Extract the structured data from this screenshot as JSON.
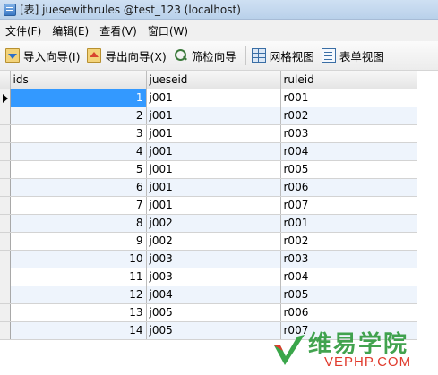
{
  "window": {
    "title": "[表] juesewithrules @test_123 (localhost)"
  },
  "menu": {
    "items": [
      {
        "label": "文件(F)",
        "name": "menu-file"
      },
      {
        "label": "编辑(E)",
        "name": "menu-edit"
      },
      {
        "label": "查看(V)",
        "name": "menu-view"
      },
      {
        "label": "窗口(W)",
        "name": "menu-window"
      }
    ]
  },
  "toolbar": {
    "import_label": "导入向导(I)",
    "export_label": "导出向导(X)",
    "filter_label": "筛检向导",
    "grid_view_label": "网格视图",
    "form_view_label": "表单视图"
  },
  "grid": {
    "columns": [
      "ids",
      "jueseid",
      "ruleid"
    ],
    "active_row": 0,
    "rows": [
      {
        "ids": "1",
        "jueseid": "j001",
        "ruleid": "r001"
      },
      {
        "ids": "2",
        "jueseid": "j001",
        "ruleid": "r002"
      },
      {
        "ids": "3",
        "jueseid": "j001",
        "ruleid": "r003"
      },
      {
        "ids": "4",
        "jueseid": "j001",
        "ruleid": "r004"
      },
      {
        "ids": "5",
        "jueseid": "j001",
        "ruleid": "r005"
      },
      {
        "ids": "6",
        "jueseid": "j001",
        "ruleid": "r006"
      },
      {
        "ids": "7",
        "jueseid": "j001",
        "ruleid": "r007"
      },
      {
        "ids": "8",
        "jueseid": "j002",
        "ruleid": "r001"
      },
      {
        "ids": "9",
        "jueseid": "j002",
        "ruleid": "r002"
      },
      {
        "ids": "10",
        "jueseid": "j003",
        "ruleid": "r003"
      },
      {
        "ids": "11",
        "jueseid": "j003",
        "ruleid": "r004"
      },
      {
        "ids": "12",
        "jueseid": "j004",
        "ruleid": "r005"
      },
      {
        "ids": "13",
        "jueseid": "j005",
        "ruleid": "r006"
      },
      {
        "ids": "14",
        "jueseid": "j005",
        "ruleid": "r007"
      }
    ]
  },
  "watermark": {
    "cn": "维易学院",
    "en": "VEPHP.COM"
  },
  "colors": {
    "selection": "#3399ff",
    "alt_row": "#eef4fc",
    "watermark_green": "#2e9a3c",
    "watermark_red": "#e03a2c"
  }
}
